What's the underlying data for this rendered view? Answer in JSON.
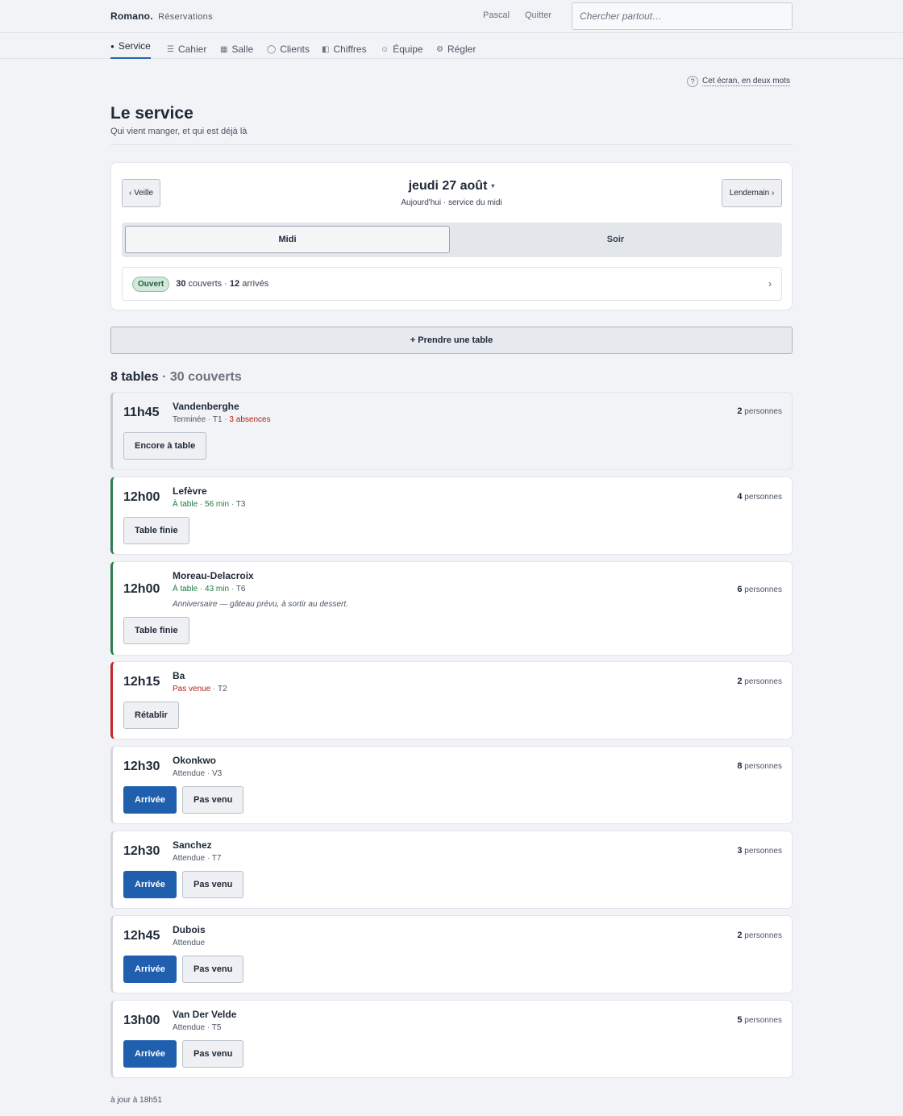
{
  "header": {
    "brand": "Romano.",
    "section": "Réservations",
    "user": "Pascal",
    "logout": "Quitter",
    "search_placeholder": "Chercher partout…"
  },
  "nav": [
    {
      "icon": "●",
      "label": "Service",
      "active": true
    },
    {
      "icon": "☰",
      "label": "Cahier"
    },
    {
      "icon": "▦",
      "label": "Salle"
    },
    {
      "icon": "◯",
      "label": "Clients"
    },
    {
      "icon": "◧",
      "label": "Chiffres"
    },
    {
      "icon": "☺",
      "label": "Équipe"
    },
    {
      "icon": "⚙",
      "label": "Régler"
    }
  ],
  "help": {
    "icon": "?",
    "label": "Cet écran, en deux mots"
  },
  "page": {
    "title": "Le service",
    "subtitle": "Qui vient manger, et qui est déjà là"
  },
  "day": {
    "prev": "‹ Veille",
    "next": "Lendemain ›",
    "date": "jeudi 27 août",
    "caret": "▾",
    "sub": "Aujourd'hui · service du midi",
    "services": [
      {
        "label": "Midi",
        "selected": true
      },
      {
        "label": "Soir",
        "selected": false
      }
    ],
    "status_badge": "Ouvert",
    "covers_num": "30",
    "covers_label": "couverts ·",
    "arrived_num": "12",
    "arrived_label": "arrivés",
    "chevron": "›"
  },
  "add_table": "+ Prendre une table",
  "summary": {
    "tables": "8 tables",
    "covers": "· 30 couverts"
  },
  "reservations": [
    {
      "time": "11h45",
      "name": "Vandenberghe",
      "status": "Terminée",
      "table": "T1",
      "extra": "3 absences",
      "party": "2",
      "actions": [
        "Encore à table"
      ]
    },
    {
      "time": "12h00",
      "name": "Lefèvre",
      "status": "À table",
      "duration": "56 min",
      "table": "T3",
      "party": "4",
      "actions": [
        "Table finie"
      ]
    },
    {
      "time": "12h00",
      "name": "Moreau-Delacroix",
      "status": "À table",
      "duration": "43 min",
      "table": "T6",
      "note": "Anniversaire — gâteau prévu, à sortir au dessert.",
      "party": "6",
      "actions": [
        "Table finie"
      ]
    },
    {
      "time": "12h15",
      "name": "Ba",
      "status": "Pas venue",
      "table": "T2",
      "party": "2",
      "actions": [
        "Rétablir"
      ]
    },
    {
      "time": "12h30",
      "name": "Okonkwo",
      "status": "Attendue",
      "table": "V3",
      "party": "8",
      "actions": [
        "Arrivée",
        "Pas venu"
      ]
    },
    {
      "time": "12h30",
      "name": "Sanchez",
      "status": "Attendue",
      "table": "T7",
      "party": "3",
      "actions": [
        "Arrivée",
        "Pas venu"
      ]
    },
    {
      "time": "12h45",
      "name": "Dubois",
      "status": "Attendue",
      "table": "",
      "party": "2",
      "actions": [
        "Arrivée",
        "Pas venu"
      ]
    },
    {
      "time": "13h00",
      "name": "Van Der Velde",
      "status": "Attendue",
      "table": "T5",
      "party": "5",
      "actions": [
        "Arrivée",
        "Pas venu"
      ]
    }
  ],
  "party_label": "personnes",
  "footer": "à jour à 18h51"
}
